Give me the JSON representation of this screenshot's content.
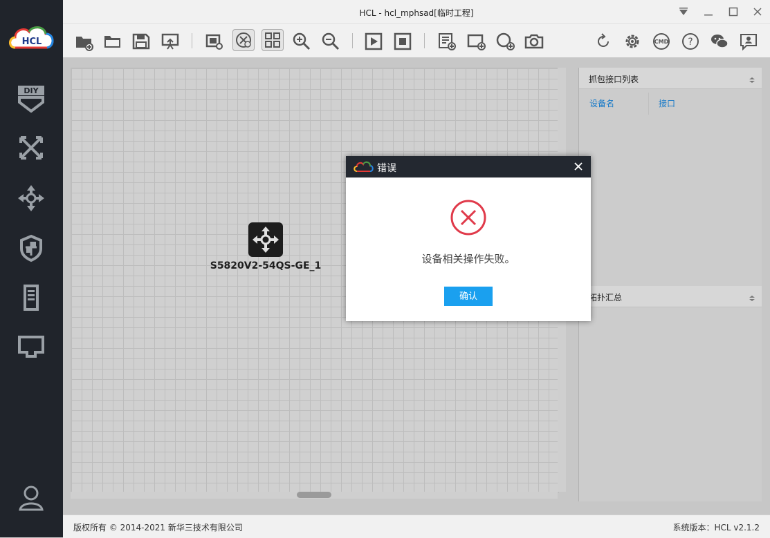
{
  "window": {
    "title": "HCL - hcl_mphsad[临时工程]"
  },
  "logo": {
    "text": "HCL"
  },
  "sidebar": {
    "items": [
      {
        "icon": "diy-icon"
      },
      {
        "icon": "topology-icon"
      },
      {
        "icon": "router-move-icon"
      },
      {
        "icon": "security-shield-icon"
      },
      {
        "icon": "server-icon"
      },
      {
        "icon": "terminal-icon"
      },
      {
        "icon": "user-icon"
      }
    ]
  },
  "toolbar": {
    "left_icons": [
      "new-project-icon",
      "open-folder-icon",
      "save-icon",
      "export-icon",
      "screen-capture-icon",
      "topology-view-icon",
      "grid-view-icon",
      "zoom-in-icon",
      "zoom-out-icon",
      "start-icon",
      "stop-icon",
      "list-add-icon",
      "add-rect-icon",
      "add-circle-icon",
      "camera-icon"
    ],
    "right_icons": [
      "refresh-icon",
      "settings-icon",
      "cmd-icon",
      "help-icon",
      "wechat-icon",
      "feedback-icon"
    ],
    "cmd_label": "CMD"
  },
  "canvas": {
    "device_label": "S5820V2-54QS-GE_1"
  },
  "right_panel": {
    "capture_header": "抓包接口列表",
    "col_device": "设备名",
    "col_interface": "接口",
    "topology_header": "拓扑汇总"
  },
  "status": {
    "copyright": "版权所有 © 2014-2021 新华三技术有限公司",
    "version": "系统版本：HCL v2.1.2"
  },
  "dialog": {
    "title": "错误",
    "message": "设备相关操作失败。",
    "ok_label": "确认"
  },
  "colors": {
    "sidebar_bg": "#20242b",
    "accent": "#1aa0ef",
    "error_red": "#e03a4a",
    "link_blue": "#1478c8"
  }
}
